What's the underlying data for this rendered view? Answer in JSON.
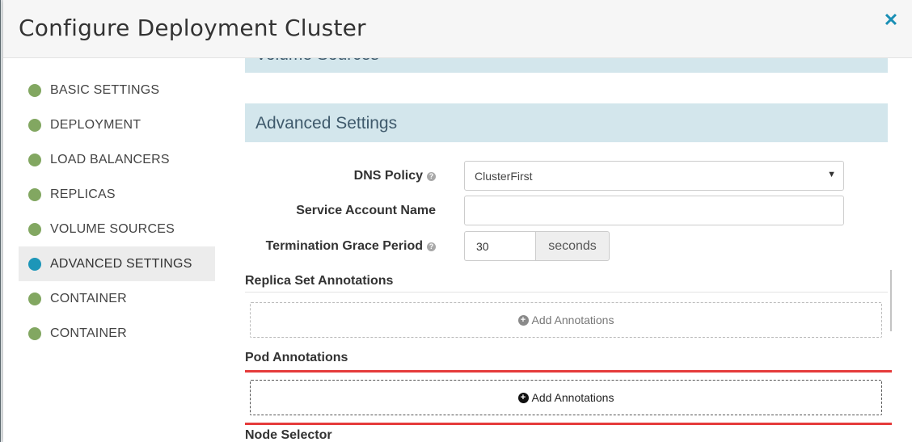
{
  "modal": {
    "title": "Configure Deployment Cluster",
    "close_icon": "close-icon"
  },
  "sidebar": {
    "items": [
      {
        "label": "BASIC SETTINGS",
        "status": "complete"
      },
      {
        "label": "DEPLOYMENT",
        "status": "complete"
      },
      {
        "label": "LOAD BALANCERS",
        "status": "complete"
      },
      {
        "label": "REPLICAS",
        "status": "complete"
      },
      {
        "label": "VOLUME SOURCES",
        "status": "complete"
      },
      {
        "label": "ADVANCED SETTINGS",
        "status": "active"
      },
      {
        "label": "CONTAINER",
        "status": "complete"
      },
      {
        "label": "CONTAINER",
        "status": "complete"
      }
    ]
  },
  "sections": {
    "volume_sources": "Volume Sources",
    "advanced_settings": "Advanced Settings"
  },
  "form": {
    "dns_policy_label": "DNS Policy",
    "dns_policy_value": "ClusterFirst",
    "service_account_label": "Service Account Name",
    "service_account_value": "",
    "termination_label": "Termination Grace Period",
    "termination_value": "30",
    "termination_unit": "seconds"
  },
  "annotations": {
    "replica_set_heading": "Replica Set Annotations",
    "pod_heading": "Pod Annotations",
    "node_selector_heading": "Node Selector",
    "add_label": "Add Annotations"
  },
  "colors": {
    "accent": "#1d96b8",
    "complete_dot": "#82a761",
    "section_bar": "#d3e6ec",
    "highlight": "#e53b3b"
  }
}
